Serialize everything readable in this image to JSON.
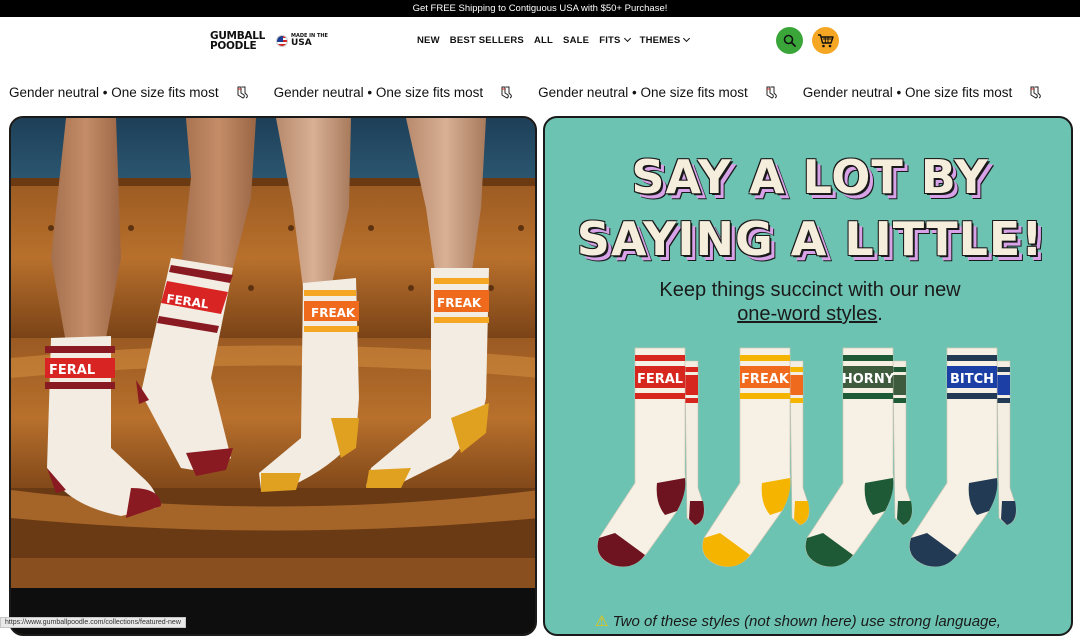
{
  "announcement": "Get FREE Shipping to Contiguous USA with $50+ Purchase!",
  "brand": {
    "line1": "GUMBALL",
    "line2": "POODLE",
    "badge_small": "MADE IN THE",
    "badge_big": "USA"
  },
  "nav": {
    "items": [
      "NEW",
      "BEST SELLERS",
      "ALL",
      "SALE",
      "FITS",
      "THEMES"
    ],
    "dropdowns": [
      "FITS",
      "THEMES"
    ]
  },
  "header_icons": {
    "search": "search-icon",
    "cart": "cart-icon",
    "search_color": "#3aa63a",
    "cart_color": "#f5a623"
  },
  "marquee": {
    "text": "Gender neutral • One size fits most",
    "icon": "sock-icon"
  },
  "promo": {
    "headline_line1": "SAY A LOT BY",
    "headline_line2": "SAYING A LITTLE!",
    "subtext": "Keep things succinct with our new",
    "link": "one-word styles",
    "link_suffix": ".",
    "warning": "Two of these styles (not shown here) use strong language,",
    "socks": [
      {
        "word": "FERAL",
        "stripe": "#d7261e",
        "trim": "#6e1420",
        "word_bg": "#d7261e"
      },
      {
        "word": "FREAK",
        "stripe": "#f5b400",
        "trim": "#f5b400",
        "word_bg": "#ef6a1c"
      },
      {
        "word": "HORNY",
        "stripe": "#1f5a37",
        "trim": "#1f5a37",
        "word_bg": "#3f5b3d"
      },
      {
        "word": "BITCH",
        "stripe": "#233a54",
        "trim": "#233a54",
        "word_bg": "#1c3fa6"
      }
    ]
  },
  "photo": {
    "sock_words": [
      "FERAL",
      "FERAL",
      "FREAK",
      "FREAK"
    ]
  },
  "status_bar": "https://www.gumballpoodle.com/collections/featured-new"
}
